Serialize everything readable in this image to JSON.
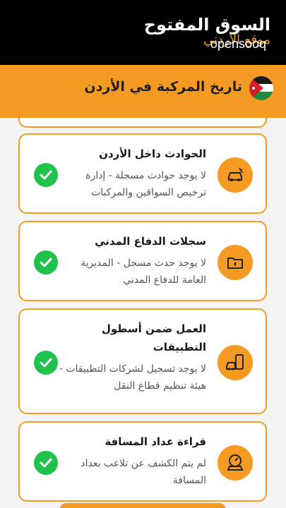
{
  "header": {
    "brand_ar": "السوق المفتوح",
    "brand_sub": "موقع الأردني",
    "brand_en": "opensooq"
  },
  "title_bar": {
    "title": "تاريخ المركبة في الأردن",
    "flag": "jordan-flag-icon"
  },
  "cards": [
    {
      "title": "الحوادث داخل الأردن",
      "description": "لا يوجد حوادث مسجلة - إدارة ترخيص السواقين والمركبات",
      "icon": "car-accident-icon",
      "status": "check-icon"
    },
    {
      "title": "سجلات الدفاع المدني",
      "description": "لا يوجد حدث مسجل - المديرية العامة للدفاع المدني",
      "icon": "folder-records-icon",
      "status": "check-icon"
    },
    {
      "title": "العمل ضمن أسطول التطبيقات",
      "description": "لا يوجد تسجيل لشركات التطبيقات - هيئة تنظيم قطاع النقل",
      "icon": "ride-app-icon",
      "status": "check-icon"
    },
    {
      "title": "قراءة عداد المسافة",
      "description": "لم يتم الكشف عن تلاعب بعداد المسافة",
      "icon": "odometer-icon",
      "status": "check-icon"
    }
  ],
  "colors": {
    "accent": "#f59a23",
    "success": "#1fc24b",
    "header_bg": "#000000"
  }
}
